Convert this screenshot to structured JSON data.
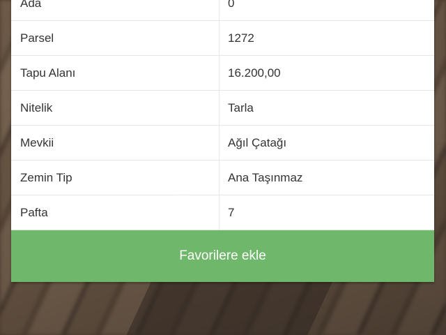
{
  "details": {
    "rows": [
      {
        "label": "Ada",
        "value": "0"
      },
      {
        "label": "Parsel",
        "value": "1272"
      },
      {
        "label": "Tapu Alanı",
        "value": "16.200,00"
      },
      {
        "label": "Nitelik",
        "value": "Tarla"
      },
      {
        "label": "Mevkii",
        "value": "Ağıl Çatağı"
      },
      {
        "label": "Zemin Tip",
        "value": "Ana Taşınmaz"
      },
      {
        "label": "Pafta",
        "value": "7"
      }
    ]
  },
  "actions": {
    "favorite_label": "Favorilere ekle"
  },
  "colors": {
    "button_green": "#6fb76a",
    "text": "#333333"
  }
}
